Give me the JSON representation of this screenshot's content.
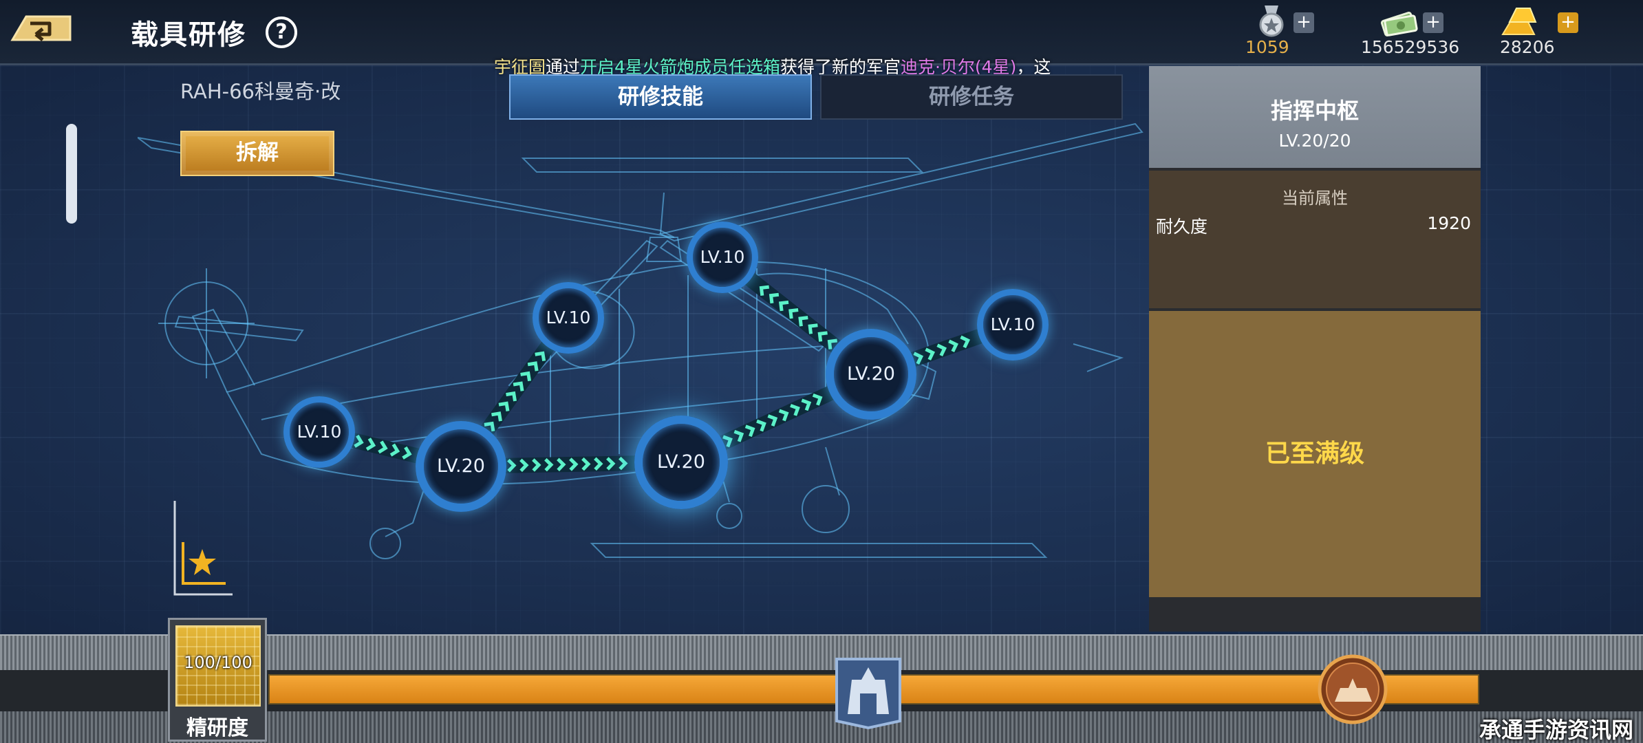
{
  "header": {
    "title": "载具研修",
    "back_icon": "back-arrow-icon",
    "help_icon": "?",
    "currencies": [
      {
        "name": "medal",
        "icon": "medal-icon",
        "value": "1059",
        "color": "#e6b04a"
      },
      {
        "name": "cash",
        "icon": "cash-icon",
        "value": "156529536",
        "color": "#e8e8e8"
      },
      {
        "name": "gold",
        "icon": "gold-bar-icon",
        "value": "28206",
        "color": "#e8e8e8"
      }
    ],
    "plus_label": "+"
  },
  "broadcast": {
    "player": "宇征圄",
    "text1": "通过",
    "item": "开启4星火箭炮成员任选箱",
    "text2": "获得了新的军官",
    "officer": "迪克·贝尔(4星)",
    "text3": "，这"
  },
  "tabs": [
    {
      "label": "研修技能",
      "active": true
    },
    {
      "label": "研修任务",
      "active": false
    }
  ],
  "vehicle": {
    "name": "RAH-66科曼奇·改",
    "dismantle_label": "拆解"
  },
  "skill_nodes": [
    {
      "label": "LV.10"
    },
    {
      "label": "LV.20"
    },
    {
      "label": "LV.10"
    },
    {
      "label": "LV.20"
    },
    {
      "label": "LV.10"
    },
    {
      "label": "LV.20"
    },
    {
      "label": "LV.10"
    }
  ],
  "panel": {
    "title": "指挥中枢",
    "level": "LV.20/20",
    "stats_header": "当前属性",
    "stat_name": "耐久度",
    "stat_value": "1920",
    "max_label": "已至满级"
  },
  "progress": {
    "value_text": "100/100",
    "fraction": 1.0,
    "label": "精研度"
  },
  "watermark": "承通手游资讯网",
  "colors": {
    "accent_gold": "#f2a434",
    "link_cyan": "#5cf2c8",
    "node_ring": "#2f7fd0"
  }
}
